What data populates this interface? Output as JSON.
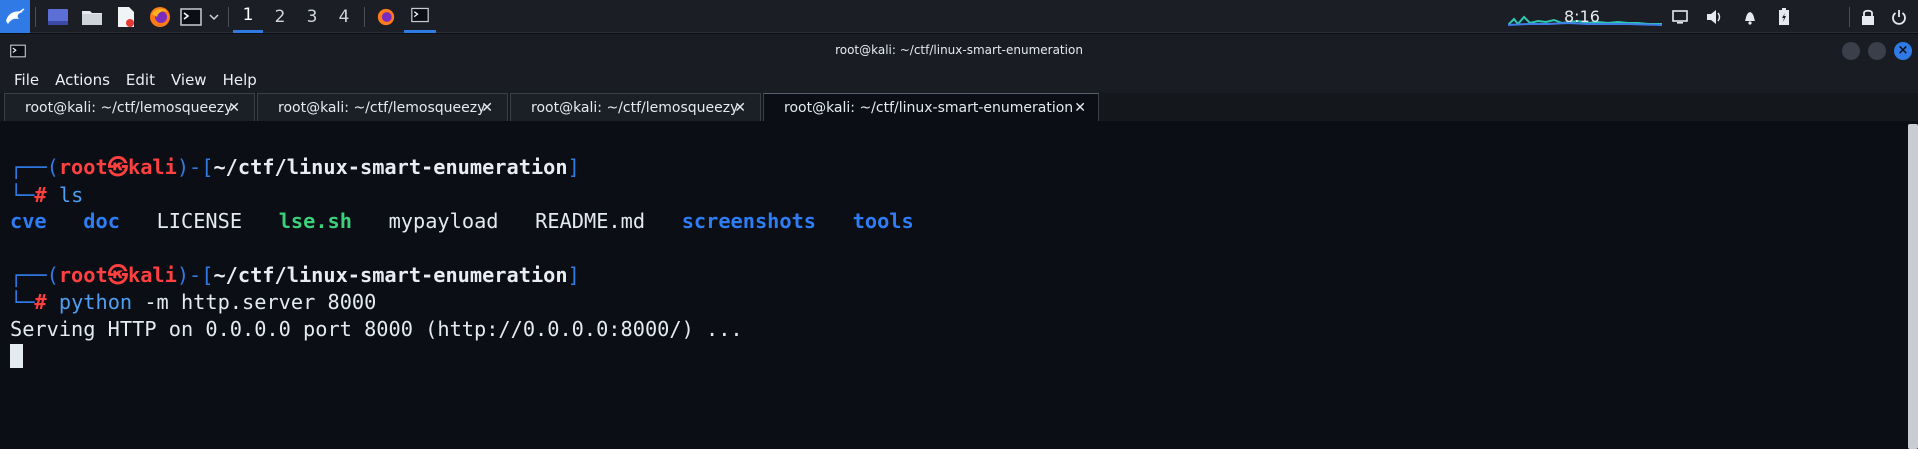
{
  "taskbar": {
    "workspaces": [
      "1",
      "2",
      "3",
      "4"
    ],
    "active_workspace": "1",
    "clock": "8:16",
    "accent_color": "#2f7ae5",
    "icons": [
      "kali-menu-icon",
      "desktop-icon",
      "file-manager-icon",
      "text-editor-icon",
      "firefox-icon",
      "terminal-icon",
      "chevron-down-icon",
      "firefox-task-icon",
      "terminal-task-icon",
      "display-icon",
      "volume-icon",
      "notification-bell-icon",
      "battery-icon",
      "lock-icon",
      "power-icon"
    ]
  },
  "window": {
    "title": "root@kali: ~/ctf/linux-smart-enumeration"
  },
  "menubar": {
    "items": [
      "File",
      "Actions",
      "Edit",
      "View",
      "Help"
    ]
  },
  "tabs": [
    {
      "label": "root@kali: ~/ctf/lemosqueezy",
      "active": false
    },
    {
      "label": "root@kali: ~/ctf/lemosqueezy",
      "active": false
    },
    {
      "label": "root@kali: ~/ctf/lemosqueezy",
      "active": false
    },
    {
      "label": "root@kali: ~/ctf/linux-smart-enumeration",
      "active": true
    }
  ],
  "terminal": {
    "prompt1": {
      "user": "root",
      "skull": "㉿",
      "host": "kali",
      "path": "~/ctf/linux-smart-enumeration",
      "hash": "#",
      "command": "ls",
      "args": ""
    },
    "ls_output": {
      "cve": "cve",
      "doc": "doc",
      "license": "LICENSE",
      "lse": "lse.sh",
      "mypayload": "mypayload",
      "readme": "README.md",
      "screenshots": "screenshots",
      "tools": "tools"
    },
    "prompt2": {
      "user": "root",
      "skull": "㉿",
      "host": "kali",
      "path": "~/ctf/linux-smart-enumeration",
      "hash": "#",
      "command": "python",
      "args": " -m http.server 8000"
    },
    "server_output": "Serving HTTP on 0.0.0.0 port 8000 (http://0.0.0.0:8000/) ..."
  }
}
